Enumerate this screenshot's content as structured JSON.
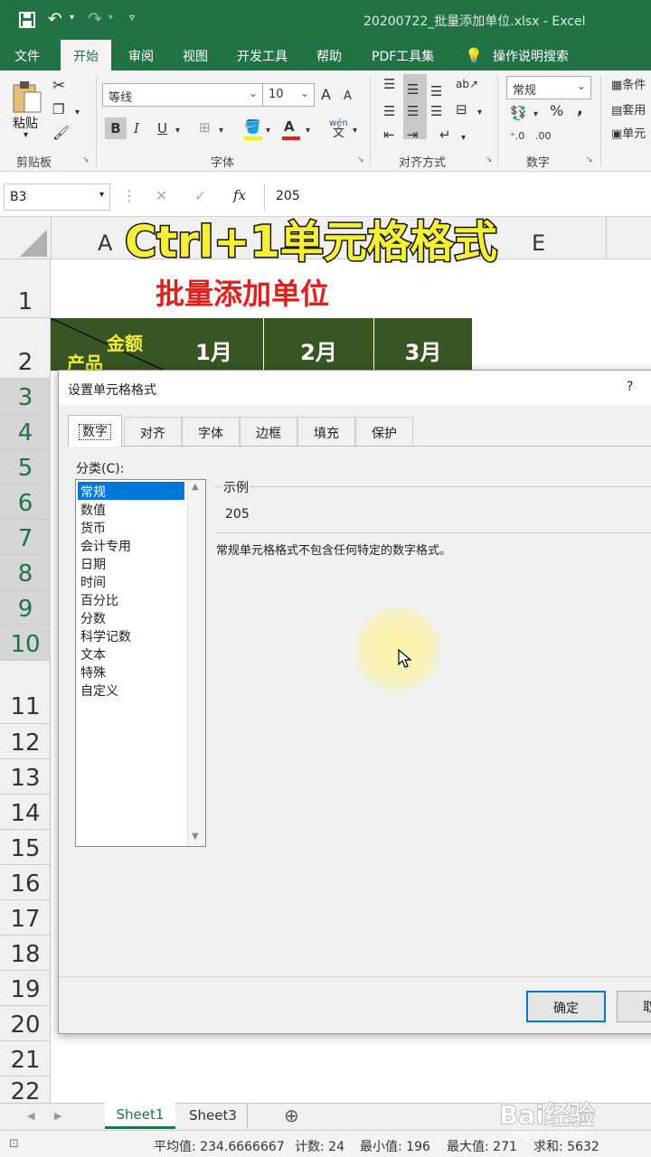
{
  "window": {
    "title": "20200722_批量添加单位.xlsx  -  Excel"
  },
  "ribbon": {
    "tabs": [
      "文件",
      "开始",
      "审阅",
      "视图",
      "开发工具",
      "帮助",
      "PDF工具集"
    ],
    "active_tab": "开始",
    "search_label": "操作说明搜索",
    "clipboard": {
      "paste": "粘贴",
      "group": "剪贴板"
    },
    "font": {
      "name": "等线",
      "size": "10",
      "group": "字体",
      "grow": "A",
      "shrink": "A",
      "bold": "B",
      "italic": "I",
      "underline": "U",
      "phonetic": "wén"
    },
    "alignment": {
      "group": "对齐方式"
    },
    "number": {
      "format": "常规",
      "group": "数字",
      "percent": "%",
      "comma": ","
    },
    "styles": {
      "items": [
        "条件",
        "套用",
        "单元"
      ]
    }
  },
  "formula_bar": {
    "name_box": "B3",
    "fx": "fx",
    "value": "205"
  },
  "overlay": {
    "headline": "Ctrl+1单元格格式"
  },
  "sheet": {
    "col_headers": {
      "a": "A",
      "e": "E"
    },
    "title": "批量添加单位",
    "corner_top": "金额",
    "corner_bottom": "产品",
    "months": [
      "1月",
      "2月",
      "3月"
    ],
    "rows": [
      "1",
      "2",
      "3",
      "4",
      "5",
      "6",
      "7",
      "8",
      "9",
      "10",
      "11",
      "12",
      "13",
      "14",
      "15",
      "16",
      "17",
      "18",
      "19",
      "20",
      "21",
      "22"
    ]
  },
  "dialog": {
    "title": "设置单元格格式",
    "help": "?",
    "tabs": [
      "数字",
      "对齐",
      "字体",
      "边框",
      "填充",
      "保护"
    ],
    "category_label": "分类(C):",
    "categories": [
      "常规",
      "数值",
      "货币",
      "会计专用",
      "日期",
      "时间",
      "百分比",
      "分数",
      "科学记数",
      "文本",
      "特殊",
      "自定义"
    ],
    "sample_label": "示例",
    "sample_value": "205",
    "description": "常规单元格格式不包含任何特定的数字格式。",
    "ok": "确定",
    "cancel": "取"
  },
  "sheet_tabs": [
    "Sheet1",
    "Sheet3"
  ],
  "status": {
    "average": "平均值: 234.6666667",
    "count": "计数: 24",
    "min": "最小值: 196",
    "max": "最大值: 271",
    "sum": "求和: 5632"
  },
  "watermark": {
    "text": "Bai经验",
    "url": "jingyan.baidu.com"
  },
  "colors": {
    "excel_green": "#217346",
    "header_fill": "#375623",
    "title_red": "#e0201c",
    "headline_yellow": "#f5ef3a"
  }
}
